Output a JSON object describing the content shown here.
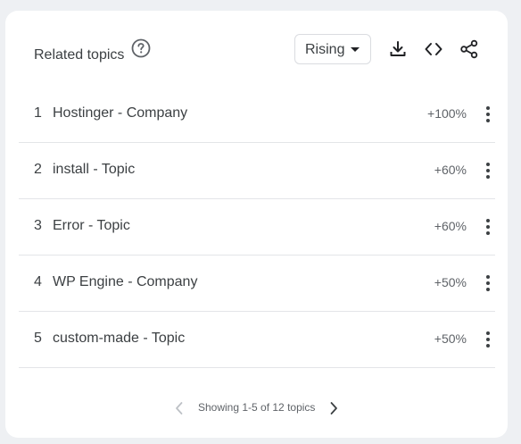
{
  "header": {
    "title": "Related topics",
    "help_icon": "help-circle-icon",
    "dropdown_value": "Rising",
    "tools": [
      "download-icon",
      "embed-code-icon",
      "share-icon"
    ]
  },
  "rows": [
    {
      "rank": "1",
      "name": "Hostinger - Company",
      "value": "+100%"
    },
    {
      "rank": "2",
      "name": "install - Topic",
      "value": "+60%"
    },
    {
      "rank": "3",
      "name": "Error - Topic",
      "value": "+60%"
    },
    {
      "rank": "4",
      "name": "WP Engine - Company",
      "value": "+50%"
    },
    {
      "rank": "5",
      "name": "custom-made - Topic",
      "value": "+50%"
    }
  ],
  "footer": {
    "pager_text": "Showing 1-5 of 12 topics"
  },
  "colors": {
    "background": "#eef0f3",
    "card": "#ffffff",
    "text": "#3c4043",
    "muted": "#5f6368",
    "divider": "#e3e5e8"
  }
}
